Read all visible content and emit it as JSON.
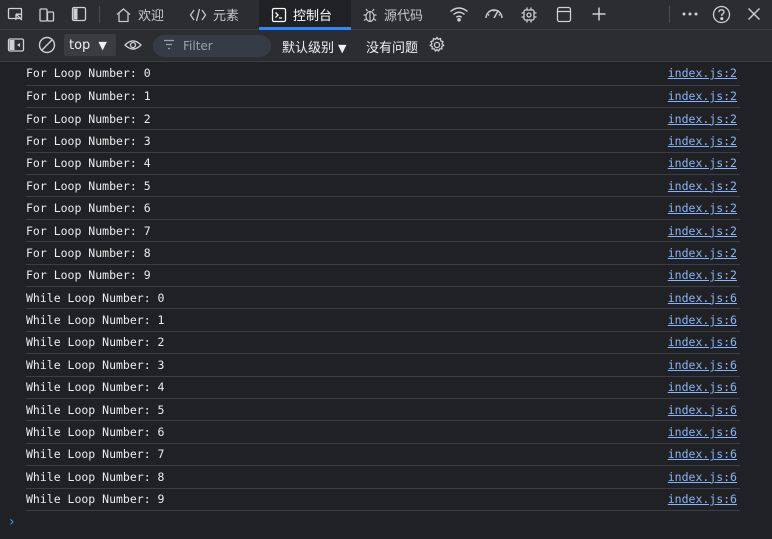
{
  "tabs": [
    {
      "label": "欢迎",
      "icon": "home-icon"
    },
    {
      "label": "元素",
      "icon": "code-icon"
    },
    {
      "label": "控制台",
      "icon": "console-icon",
      "active": true
    },
    {
      "label": "源代码",
      "icon": "bug-icon"
    }
  ],
  "toolbar": {
    "context": "top",
    "filter_placeholder": "Filter",
    "level": "默认级别",
    "issues": "没有问题"
  },
  "messages": [
    {
      "text": "For Loop Number: 0",
      "source": "index.js:2"
    },
    {
      "text": "For Loop Number: 1",
      "source": "index.js:2"
    },
    {
      "text": "For Loop Number: 2",
      "source": "index.js:2"
    },
    {
      "text": "For Loop Number: 3",
      "source": "index.js:2"
    },
    {
      "text": "For Loop Number: 4",
      "source": "index.js:2"
    },
    {
      "text": "For Loop Number: 5",
      "source": "index.js:2"
    },
    {
      "text": "For Loop Number: 6",
      "source": "index.js:2"
    },
    {
      "text": "For Loop Number: 7",
      "source": "index.js:2"
    },
    {
      "text": "For Loop Number: 8",
      "source": "index.js:2"
    },
    {
      "text": "For Loop Number: 9",
      "source": "index.js:2"
    },
    {
      "text": "While Loop Number: 0",
      "source": "index.js:6"
    },
    {
      "text": "While Loop Number: 1",
      "source": "index.js:6"
    },
    {
      "text": "While Loop Number: 2",
      "source": "index.js:6"
    },
    {
      "text": "While Loop Number: 3",
      "source": "index.js:6"
    },
    {
      "text": "While Loop Number: 4",
      "source": "index.js:6"
    },
    {
      "text": "While Loop Number: 5",
      "source": "index.js:6"
    },
    {
      "text": "While Loop Number: 6",
      "source": "index.js:6"
    },
    {
      "text": "While Loop Number: 7",
      "source": "index.js:6"
    },
    {
      "text": "While Loop Number: 8",
      "source": "index.js:6"
    },
    {
      "text": "While Loop Number: 9",
      "source": "index.js:6"
    }
  ],
  "prompt": "›",
  "colors": {
    "accent": "#2f86ff",
    "link": "#8ab4f8",
    "background": "#1f2125"
  }
}
